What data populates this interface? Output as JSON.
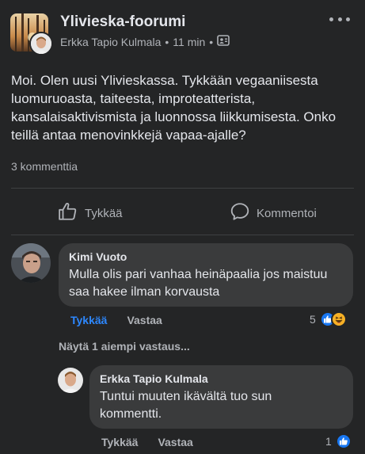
{
  "post": {
    "group_name": "Ylivieska-foorumi",
    "author": "Erkka Tapio Kulmala",
    "time": "11 min",
    "text": "Moi. Olen uusi Ylivieskassa. Tykkään vegaaniisesta luomuruoasta, taiteesta, improteatterista, kansalaisaktivismista ja luonnossa liikkumisesta. Onko teillä antaa menovinkkejä vapaa-ajalle?",
    "comment_count": "3 kommenttia",
    "like_label": "Tykkää",
    "comment_label": "Kommentoi"
  },
  "comments": [
    {
      "author": "Kimi Vuoto",
      "text": "Mulla olis pari vanhaa heinäpaalia jos maistuu saa hakee ilman korvausta",
      "like_label": "Tykkää",
      "reply_label": "Vastaa",
      "reaction_count": "5",
      "reactions": [
        "like-icon",
        "haha-icon"
      ],
      "liked_by_viewer": true
    }
  ],
  "more_replies_label": "Näytä 1 aiempi vastaus...",
  "replies": [
    {
      "author": "Erkka Tapio Kulmala",
      "text": "Tuntui muuten ikävältä tuo sun kommentti.",
      "like_label": "Tykkää",
      "reply_label": "Vastaa",
      "reaction_count": "1",
      "reactions": [
        "like-icon"
      ]
    }
  ],
  "colors": {
    "background": "#242526",
    "bubble": "#3a3b3c",
    "text": "#e4e6eb",
    "secondary_text": "#b0b3b8",
    "accent": "#2d88ff",
    "like_blue": "#1877f2",
    "haha_yellow": "#f7b125"
  }
}
